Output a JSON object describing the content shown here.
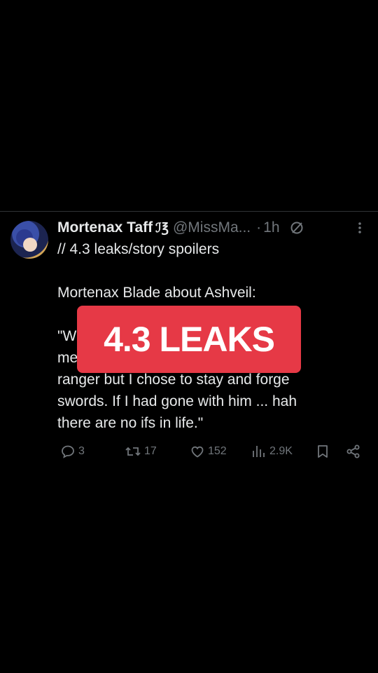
{
  "tweet": {
    "author_name": "Mortenax Taff",
    "author_emoji": "ℐ℥",
    "handle": "@MissMa...",
    "separator": "·",
    "time": "1h",
    "lines": [
      "// 4.3 leaks/story spoilers",
      "",
      "Mortenax Blade about Ashveil:",
      "",
      "\"W                                        onvince",
      "me                                                 e a",
      "ranger but I chose to stay and forge",
      "swords. If I had gone with him ... hah",
      "there are no ifs in life.\""
    ],
    "banner_text": "4.3 LEAKS"
  },
  "actions": {
    "replies": "3",
    "reposts": "17",
    "likes": "152",
    "views": "2.9K"
  },
  "icons": {
    "avatar": "avatar",
    "grok": "grok-icon",
    "more": "more-icon",
    "reply": "reply-icon",
    "repost": "repost-icon",
    "like": "heart-icon",
    "views": "views-icon",
    "bookmark": "bookmark-icon",
    "share": "share-icon"
  },
  "colors": {
    "background": "#000000",
    "text": "#e7e9ea",
    "muted": "#71767b",
    "banner": "#e63946"
  }
}
